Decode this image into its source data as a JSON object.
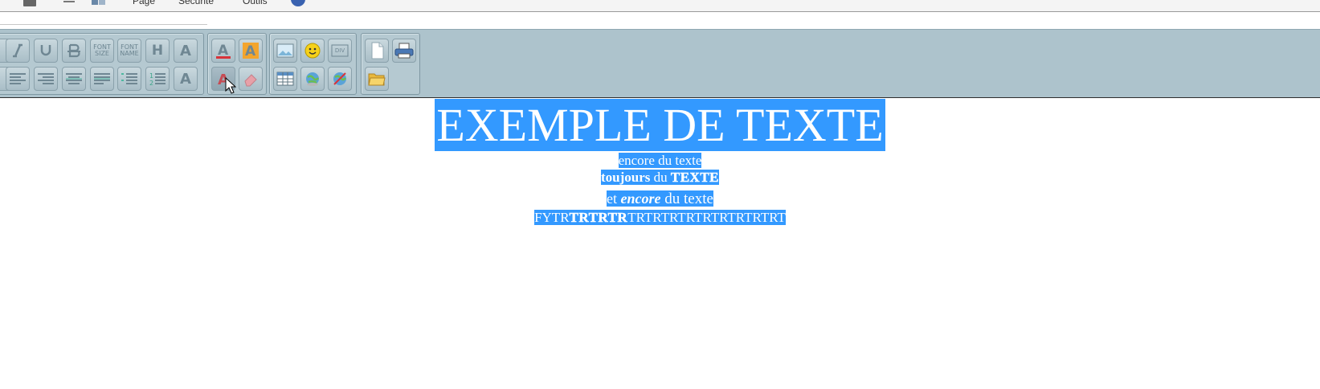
{
  "menubar": {
    "items": [
      "Page",
      "Sécurité",
      "Outils"
    ]
  },
  "toolbar": {
    "font_size_label": [
      "FONT",
      "SIZE"
    ],
    "font_name_label": [
      "FONT",
      "NAME"
    ],
    "heading_label": "H",
    "superscript_label": "A",
    "subscript_label": "A",
    "div_label": "DIV",
    "accent": "#adc3cc"
  },
  "content": {
    "title": "EXEMPLE DE TEXTE",
    "line2": "encore du texte",
    "line3_bold": "toujours",
    "line3_mid": " du ",
    "line3_word": "TEXTE",
    "line4_a": "et ",
    "line4_italic": "encore",
    "line4_b": " du texte",
    "line5_a": "FYTR",
    "line5_b": "TRTRTR",
    "line5_c": "TRTRTRTRTRTRTRTRTRT",
    "selection_color": "#3399ff"
  }
}
